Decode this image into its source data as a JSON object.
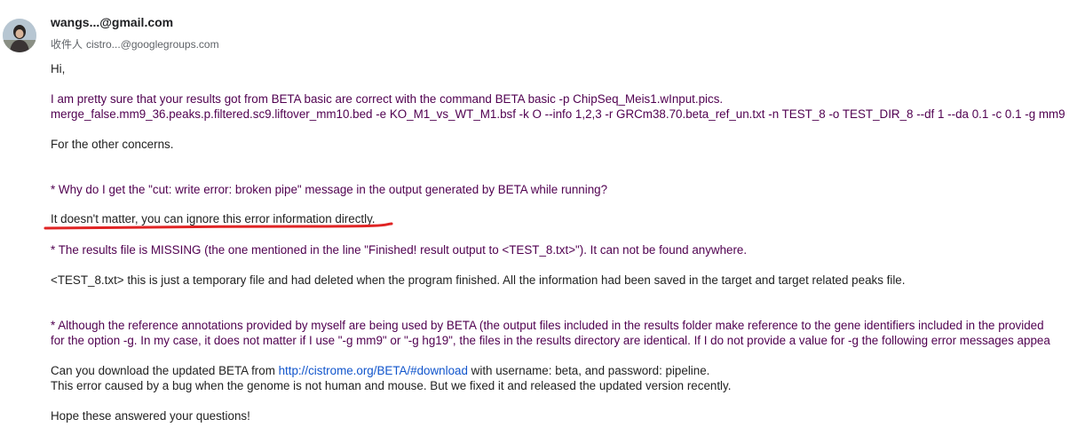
{
  "header": {
    "sender_email": "wangs...@gmail.com",
    "recipient_label": "收件人",
    "recipient_email": "cistro...@googlegroups.com"
  },
  "message": {
    "greeting": "Hi,",
    "p1_line1": "I am pretty sure that your results got from BETA basic are correct with the command BETA basic -p ChipSeq_Meis1.wInput.pics.",
    "p1_line2": "merge_false.mm9_36.peaks.p.filtered.sc9.liftover_mm10.bed -e KO_M1_vs_WT_M1.bsf -k O --info 1,2,3 -r GRCm38.70.beta_ref_un.txt -n TEST_8 -o TEST_DIR_8 --df 1 --da 0.1 -c 0.1 -g mm9",
    "other_concerns": "For the other concerns.",
    "q1": "* Why do I get the \"cut: write error: broken pipe\" message in the output generated by BETA while running?",
    "a1": "It doesn't matter, you can ignore this error information directly.",
    "q2": "* The results file is MISSING (the one mentioned in the line \"Finished! result output to <TEST_8.txt>\"). It can not be found anywhere.",
    "a2": "<TEST_8.txt> this is just a temporary file and had deleted when the program finished. All the information had been saved in the target and target related peaks file.",
    "q3_line1": "* Although the reference annotations provided by myself are being used by BETA (the output files included in the results folder make reference to the gene identifiers included in the provided",
    "q3_line2": "for the option -g. In my case, it does not matter if I use \"-g mm9\" or \"-g hg19\", the files in the results directory are identical. If I do not provide a value for -g the following error messages appea",
    "a3_prefix": "Can you download the updated BETA from ",
    "a3_link": "http://cistrome.org/BETA/#download",
    "a3_suffix": " with username: beta, and password: pipeline.",
    "a3_line2": "This error caused by a bug when the genome is not human and mouse. But we fixed it and released the updated version recently.",
    "closing": "Hope these answered your questions!"
  },
  "annotation": {
    "underline_color": "#e02424"
  }
}
